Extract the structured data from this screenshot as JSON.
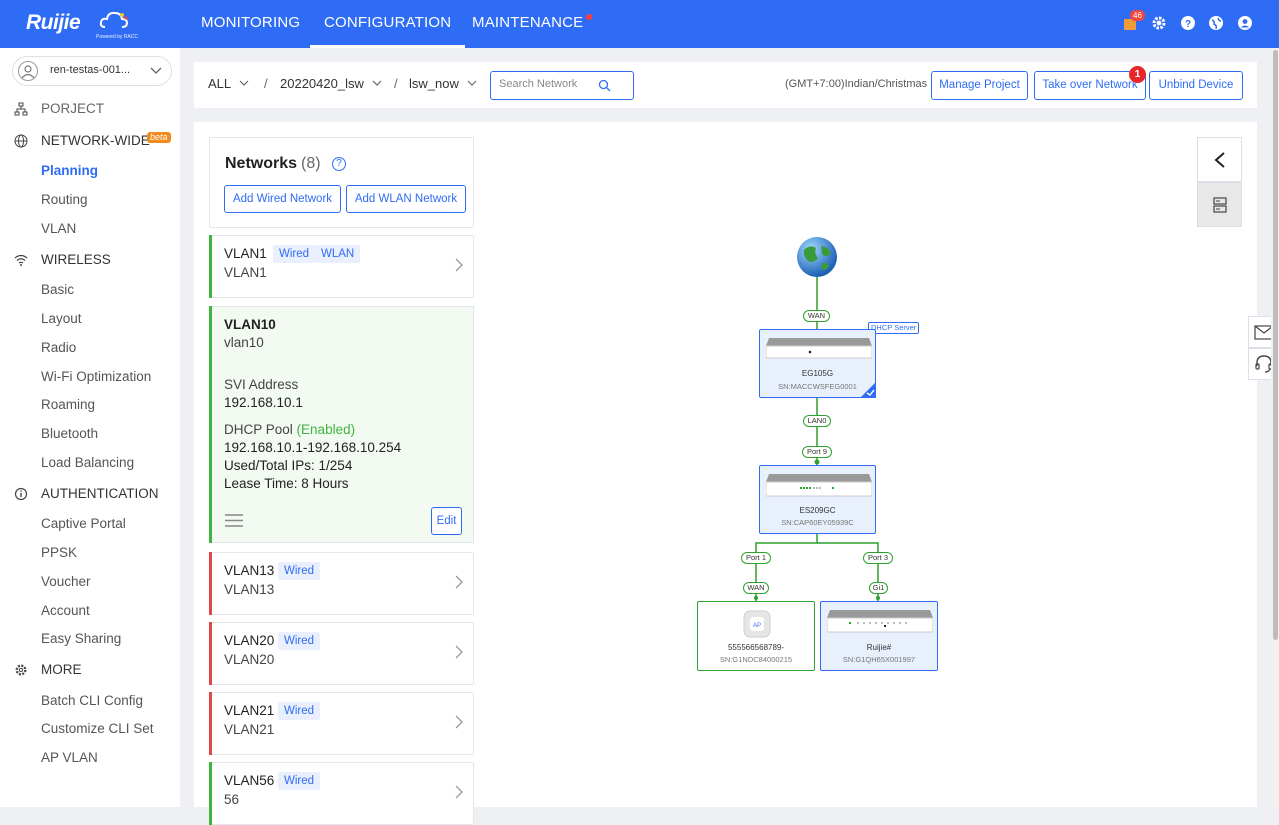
{
  "header": {
    "brand": "Ruijie",
    "brand_tag": "Powered by RACC",
    "nav": [
      {
        "label": "MONITORING"
      },
      {
        "label": "CONFIGURATION"
      },
      {
        "label": "MAINTENANCE"
      }
    ],
    "notification_count": "46"
  },
  "sidebar": {
    "user_name": "ren-testas-001...",
    "sections": {
      "project": "PORJECT",
      "network_wide": "NETWORK-WIDE",
      "beta": "beta",
      "wireless": "WIRELESS",
      "authentication": "AUTHENTICATION",
      "more": "MORE"
    },
    "network_items": [
      "Planning",
      "Routing",
      "VLAN"
    ],
    "wireless_items": [
      "Basic",
      "Layout",
      "Radio",
      "Wi-Fi Optimization",
      "Roaming",
      "Bluetooth",
      "Load Balancing"
    ],
    "auth_items": [
      "Captive Portal",
      "PPSK",
      "Voucher",
      "Account",
      "Easy Sharing"
    ],
    "more_items": [
      "Batch CLI Config",
      "Customize CLI Set",
      "AP VLAN"
    ]
  },
  "toolbar": {
    "crumb_all": "ALL",
    "crumb_project": "20220420_lsw",
    "crumb_network": "lsw_now",
    "search_placeholder": "Search Network",
    "timezone": "(GMT+7:00)Indian/Christmas",
    "manage_project": "Manage Project",
    "take_over": "Take over Network",
    "take_over_badge": "1",
    "unbind": "Unbind Device"
  },
  "networks": {
    "title": "Networks",
    "count": "(8)",
    "add_wired": "Add Wired Network",
    "add_wlan": "Add WLAN Network",
    "tag_wired": "Wired",
    "tag_wlan": "WLAN",
    "vlan1": {
      "name": "VLAN1",
      "sub": "VLAN1"
    },
    "vlan10": {
      "name": "VLAN10",
      "sub": "vlan10",
      "svi_label": "SVI Address",
      "svi_value": "192.168.10.1",
      "dhcp_label": "DHCP Pool",
      "dhcp_status": "(Enabled)",
      "dhcp_range": "192.168.10.1-192.168.10.254",
      "used": "Used/Total IPs: 1/254",
      "lease": "Lease Time: 8 Hours",
      "edit": "Edit"
    },
    "vlan13": {
      "name": "VLAN13",
      "sub": "VLAN13"
    },
    "vlan20": {
      "name": "VLAN20",
      "sub": "VLAN20"
    },
    "vlan21": {
      "name": "VLAN21",
      "sub": "VLAN21"
    },
    "vlan56": {
      "name": "VLAN56",
      "sub": "56"
    }
  },
  "topology": {
    "wan_label": "WAN",
    "dhcp_server": "DHCP Server",
    "gateway": {
      "name": "EG105G",
      "sn": "SN:MACCWSFEG0001"
    },
    "lan_label": "LAN0",
    "port9": "Port 9",
    "switch": {
      "name": "ES209GC",
      "sn": "SN:CAP60EY05939C"
    },
    "port1": "Port 1",
    "port3": "Port 3",
    "wan2": "WAN",
    "gi1": "Gi1",
    "ap": {
      "name": "555566568789-",
      "sn": "SN:G1NDC84000215"
    },
    "switch2": {
      "name": "Ruijie#",
      "sn": "SN:G1QH65X001997"
    }
  },
  "colors": {
    "brand_blue": "#2f6cf5",
    "link_green": "#2da12d",
    "vlan_red": "#e04848"
  }
}
